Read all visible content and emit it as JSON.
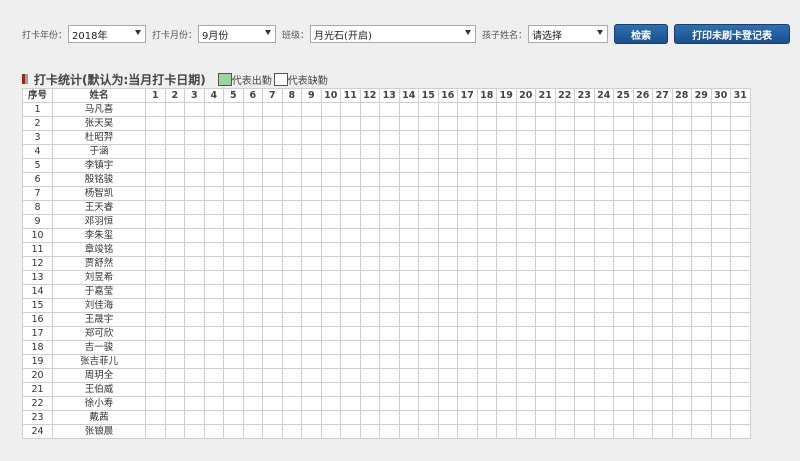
{
  "filters": {
    "year_label": "打卡年份：",
    "year_value": "2018年",
    "month_label": "打卡月份：",
    "month_value": "9月份",
    "class_label": "班级：",
    "class_value": "月光石(开启)",
    "child_label": "孩子姓名：",
    "child_value": "请选择",
    "search_button": "检索",
    "print_button": "打印未刷卡登记表"
  },
  "section": {
    "title": "打卡统计(默认为:当月打卡日期)",
    "legend_present": "代表出勤",
    "legend_absent": "代表缺勤",
    "present_color": "#9ed59e",
    "title_mark_color": "#b71c1c"
  },
  "table": {
    "col_seq": "序号",
    "col_name": "姓名",
    "days": [
      "1",
      "2",
      "3",
      "4",
      "5",
      "6",
      "7",
      "8",
      "9",
      "10",
      "11",
      "12",
      "13",
      "14",
      "15",
      "16",
      "17",
      "18",
      "19",
      "20",
      "21",
      "22",
      "23",
      "24",
      "25",
      "26",
      "27",
      "28",
      "29",
      "30",
      "31"
    ],
    "rows": [
      {
        "no": "1",
        "name": "马凡喜"
      },
      {
        "no": "2",
        "name": "张天昊"
      },
      {
        "no": "3",
        "name": "杜昭羿"
      },
      {
        "no": "4",
        "name": "于涵"
      },
      {
        "no": "5",
        "name": "李镇宇"
      },
      {
        "no": "6",
        "name": "殷铭骏"
      },
      {
        "no": "7",
        "name": "杨智凯"
      },
      {
        "no": "8",
        "name": "王天睿"
      },
      {
        "no": "9",
        "name": "邓羽恒"
      },
      {
        "no": "10",
        "name": "李朱玺"
      },
      {
        "no": "11",
        "name": "章竣铭"
      },
      {
        "no": "12",
        "name": "贾舒然"
      },
      {
        "no": "13",
        "name": "刘昱希"
      },
      {
        "no": "14",
        "name": "于嘉莹"
      },
      {
        "no": "15",
        "name": "刘佳海"
      },
      {
        "no": "16",
        "name": "王晟宇"
      },
      {
        "no": "17",
        "name": "郑可欣"
      },
      {
        "no": "18",
        "name": "吉一骏"
      },
      {
        "no": "19",
        "name": "张吉菲儿"
      },
      {
        "no": "20",
        "name": "周玥全"
      },
      {
        "no": "21",
        "name": "王伯威"
      },
      {
        "no": "22",
        "name": "徐小寿"
      },
      {
        "no": "23",
        "name": "戴茜"
      },
      {
        "no": "24",
        "name": "张锒晨"
      }
    ]
  }
}
